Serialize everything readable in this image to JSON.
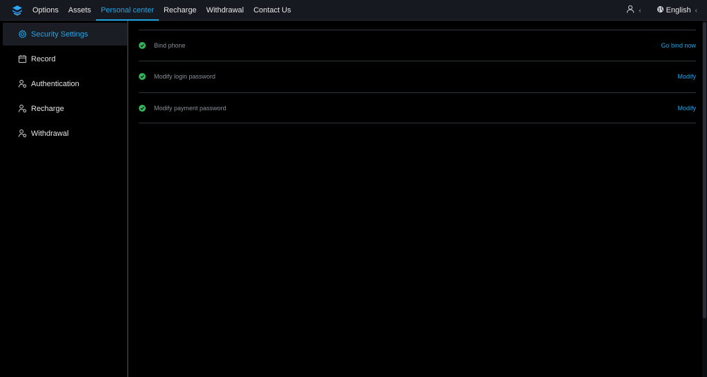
{
  "nav": {
    "items": [
      {
        "label": "Options"
      },
      {
        "label": "Assets"
      },
      {
        "label": "Personal center",
        "active": true
      },
      {
        "label": "Recharge"
      },
      {
        "label": "Withdrawal"
      },
      {
        "label": "Contact Us"
      }
    ]
  },
  "header": {
    "user_icon": "user-icon",
    "language_label": "English",
    "language_icon": "globe-icon"
  },
  "sidebar": {
    "items": [
      {
        "label": "Security Settings",
        "icon": "gear-icon",
        "active": true
      },
      {
        "label": "Record",
        "icon": "calendar-icon"
      },
      {
        "label": "Authentication",
        "icon": "user-check-icon"
      },
      {
        "label": "Recharge",
        "icon": "user-check-icon"
      },
      {
        "label": "Withdrawal",
        "icon": "user-check-icon"
      }
    ]
  },
  "security": {
    "rows": [
      {
        "label": "Bind phone",
        "action": "Go bind now"
      },
      {
        "label": "Modify login password",
        "action": "Modify"
      },
      {
        "label": "Modify payment password",
        "action": "Modify"
      }
    ]
  },
  "colors": {
    "accent": "#21a6e8",
    "success": "#33b35a",
    "topbar_bg": "#16191f",
    "page_bg": "#000000"
  }
}
